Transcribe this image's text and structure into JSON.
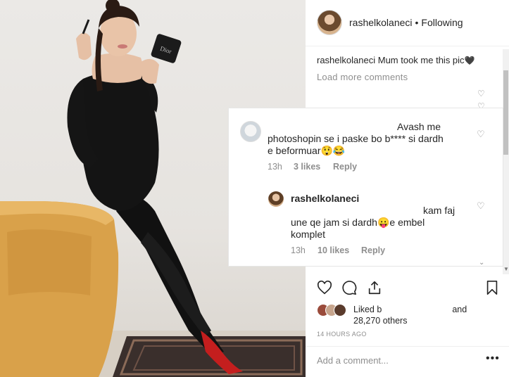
{
  "post": {
    "username": "rashelkolaneci",
    "separator": "•",
    "follow_status": "Following",
    "caption_user": "rashelkolaneci",
    "caption_text": "Mum took me this pic",
    "caption_emoji": "🖤",
    "load_more": "Load more comments"
  },
  "overlay": {
    "comment1": {
      "line1": "Avash me",
      "line2": "photoshopin se i paske bo  b**** si dardh",
      "line3": "e beformuar😲😂",
      "time": "13h",
      "likes": "3 likes",
      "reply": "Reply"
    },
    "comment2": {
      "username": "rashelkolaneci",
      "line1": "kam faj",
      "line2": "une qe jam si dardh😛e embel",
      "line3": "komplet",
      "time": "13h",
      "likes": "10 likes",
      "reply": "Reply"
    }
  },
  "likes": {
    "line1_prefix": "Liked b",
    "line1_suffix": "and",
    "line2": "28,270 others"
  },
  "timestamp": "14 HOURS AGO",
  "comment_input": {
    "placeholder": "Add a comment..."
  },
  "more_glyph": "•••",
  "icons": {
    "heart": "heart-icon",
    "comment": "comment-icon",
    "share": "share-icon",
    "save": "bookmark-icon"
  }
}
